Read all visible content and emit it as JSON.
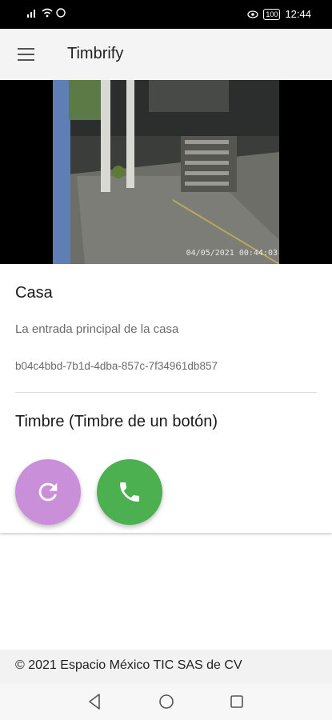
{
  "status_bar": {
    "time": "12:44",
    "battery": "100",
    "icons": [
      "signal-icon",
      "wifi-icon",
      "whatsapp-icon",
      "eye-icon",
      "battery-icon"
    ]
  },
  "app_bar": {
    "title": "Timbrify",
    "menu_icon": "menu-icon"
  },
  "camera": {
    "timestamp": "04/05/2021 00:44:03"
  },
  "device": {
    "name": "Casa",
    "description": "La entrada principal de la casa",
    "id": "b04c4bbd-7b1d-4dba-857c-7f34961db857"
  },
  "doorbell": {
    "title": "Timbre (Timbre de un botón)",
    "refresh_icon": "refresh-icon",
    "call_icon": "phone-icon",
    "colors": {
      "refresh": "#c98fd8",
      "call": "#4caf50"
    }
  },
  "footer": {
    "copyright": "© 2021 Espacio México TIC SAS de CV"
  },
  "nav_bar": {
    "icons": [
      "back-icon",
      "home-icon",
      "recents-icon"
    ]
  }
}
